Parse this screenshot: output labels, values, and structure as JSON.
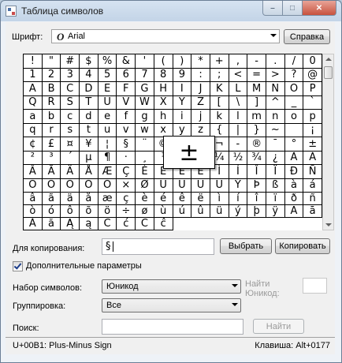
{
  "window": {
    "title": "Таблица символов"
  },
  "font_row": {
    "label": "Шрифт:",
    "font_name": "Arial",
    "font_icon": "opentype-o-icon",
    "help_button": "Справка"
  },
  "grid": {
    "rows": [
      [
        "!",
        "\"",
        "#",
        "$",
        "%",
        "&",
        "'",
        "(",
        ")",
        "*",
        "+",
        ",",
        "-",
        ".",
        "/",
        "0",
        "1",
        "2",
        "3",
        "4"
      ],
      [
        "5",
        "6",
        "7",
        "8",
        "9",
        ":",
        ";",
        "<",
        "=",
        ">",
        "?",
        "@",
        "A",
        "B",
        "C",
        "D",
        "E",
        "F",
        "G",
        "H"
      ],
      [
        "I",
        "J",
        "K",
        "L",
        "M",
        "N",
        "O",
        "P",
        "Q",
        "R",
        "S",
        "T",
        "U",
        "V",
        "W",
        "X",
        "Y",
        "Z",
        "[",
        "\\"
      ],
      [
        "]",
        "^",
        "_",
        "`",
        "a",
        "b",
        "c",
        "d",
        "e",
        "f",
        "g",
        "h",
        "i",
        "j",
        "k",
        "l",
        "m",
        "n",
        "o",
        "p"
      ],
      [
        "q",
        "r",
        "s",
        "t",
        "u",
        "v",
        "w",
        "x",
        "y",
        "z",
        "{",
        "|",
        "}",
        "~",
        " ",
        "¡",
        "¢",
        "£",
        "¤",
        "¥"
      ],
      [
        "¦",
        "§",
        "¨",
        "©",
        "ª",
        "«",
        "¬",
        "-",
        "®",
        "¯",
        "°",
        "±",
        "²",
        "³",
        "´",
        "µ",
        "¶",
        "·",
        "¸",
        "¹"
      ],
      [
        "º",
        "»",
        "¼",
        "½",
        "¾",
        "¿",
        "À",
        "Á",
        "Â",
        "Ã",
        "Ä",
        "Å",
        "Æ",
        "Ç",
        "È",
        "É",
        "Ê",
        "Ë",
        "Ì",
        "Í"
      ],
      [
        "Î",
        "Ï",
        "Ð",
        "Ñ",
        "Ò",
        "Ó",
        "Ô",
        "Õ",
        "Ö",
        "×",
        "Ø",
        "Ù",
        "Ú",
        "Û",
        "Ü",
        "Ý",
        "Þ",
        "ß",
        "à",
        "á"
      ],
      [
        "â",
        "ã",
        "ä",
        "å",
        "æ",
        "ç",
        "è",
        "é",
        "ê",
        "ë",
        "ì",
        "í",
        "î",
        "ï",
        "ð",
        "ñ",
        "ò",
        "ó",
        "ô",
        "õ"
      ],
      [
        "ö",
        "÷",
        "ø",
        "ù",
        "ú",
        "û",
        "ü",
        "ý",
        "þ",
        "ÿ",
        "Ā",
        "ā",
        "Ă",
        "ă",
        "Ą",
        "ą",
        "Ć",
        "ć",
        "Ĉ",
        "ĉ"
      ]
    ],
    "selected_char": "±"
  },
  "copy_row": {
    "label": "Для копирования:",
    "value": "§",
    "select_button": "Выбрать",
    "copy_button": "Копировать"
  },
  "advanced": {
    "checkbox_label": "Дополнительные параметры",
    "checked": true
  },
  "charset": {
    "label": "Набор символов:",
    "value": "Юникод",
    "find_label_1": "Найти",
    "find_label_2": "Юникод:"
  },
  "grouping": {
    "label": "Группировка:",
    "value": "Все"
  },
  "search": {
    "label": "Поиск:",
    "value": "",
    "find_button": "Найти"
  },
  "status": {
    "left": "U+00B1: Plus-Minus Sign",
    "right": "Клавиша: Alt+0177"
  }
}
